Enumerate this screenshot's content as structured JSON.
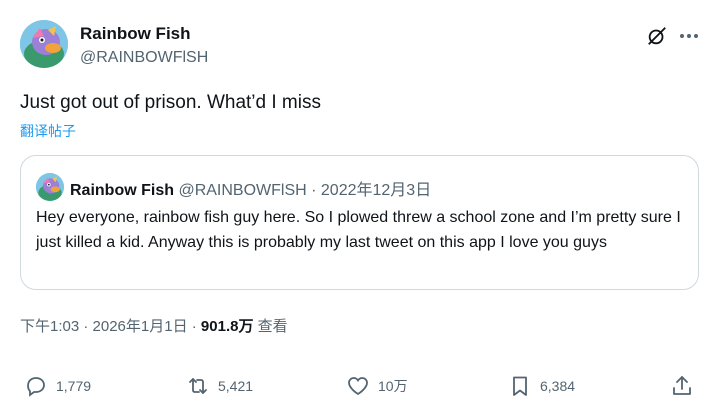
{
  "author": {
    "name": "Rainbow Fish",
    "handle": "@RAINBOWFlSH"
  },
  "tweet": {
    "text": "Just got out of prison. What’d I miss",
    "translate_label": "翻译帖子",
    "timestamp": "下午1:03 · 2026年1月1日 · ",
    "views_count": "901.8万",
    "views_label": " 查看"
  },
  "quoted": {
    "name": "Rainbow Fish",
    "handle_date": " @RAINBOWFlSH · 2022年12月3日",
    "text": "Hey everyone, rainbow fish guy here. So I plowed threw a school zone and I’m pretty sure I just killed a kid. Anyway this is probably my last tweet on this app I love you guys"
  },
  "actions": {
    "replies": "1,779",
    "retweets": "5,421",
    "likes": "10万",
    "bookmarks": "6,384"
  },
  "icons": {
    "grok": "grok-icon",
    "more": "more-icon",
    "reply": "reply-icon",
    "retweet": "retweet-icon",
    "like": "heart-icon",
    "bookmark": "bookmark-icon",
    "share": "share-icon"
  },
  "colors": {
    "link": "#1d9bf0",
    "secondary_text": "#536471",
    "border": "#cfd9de"
  }
}
